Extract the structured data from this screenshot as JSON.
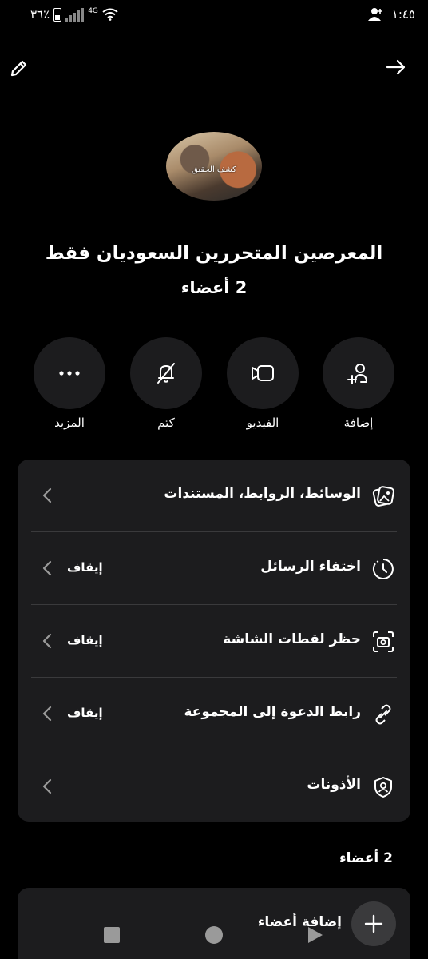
{
  "status_bar": {
    "battery_text": "٣٦٪",
    "network": "4G",
    "time": "١:٤٥"
  },
  "top_bar": {
    "edit_icon": "pencil-icon",
    "back_icon": "arrow-right-icon"
  },
  "group": {
    "avatar_caption": "كشف الحقيق",
    "name": "المعرصين المتحررين السعوديان فقط",
    "member_count": "2 أعضاء"
  },
  "actions": [
    {
      "label": "المزيد",
      "icon": "more-dots-icon"
    },
    {
      "label": "كتم",
      "icon": "bell-off-icon"
    },
    {
      "label": "الفيديو",
      "icon": "video-icon"
    },
    {
      "label": "إضافة",
      "icon": "add-person-icon"
    }
  ],
  "settings": [
    {
      "label": "الوسائط، الروابط، المستندات",
      "value": "",
      "icon": "media-icon"
    },
    {
      "label": "اختفاء الرسائل",
      "value": "إيقاف",
      "icon": "timer-icon"
    },
    {
      "label": "حظر لقطات الشاشة",
      "value": "إيقاف",
      "icon": "screenshot-block-icon"
    },
    {
      "label": "رابط الدعوة إلى المجموعة",
      "value": "إيقاف",
      "icon": "link-icon"
    },
    {
      "label": "الأذونات",
      "value": "",
      "icon": "shield-user-icon"
    }
  ],
  "members": {
    "heading": "2 أعضاء",
    "add_label": "إضافة أعضاء"
  },
  "colors": {
    "background": "#000000",
    "card": "#1c1c1e",
    "divider": "#3a3a3c"
  }
}
